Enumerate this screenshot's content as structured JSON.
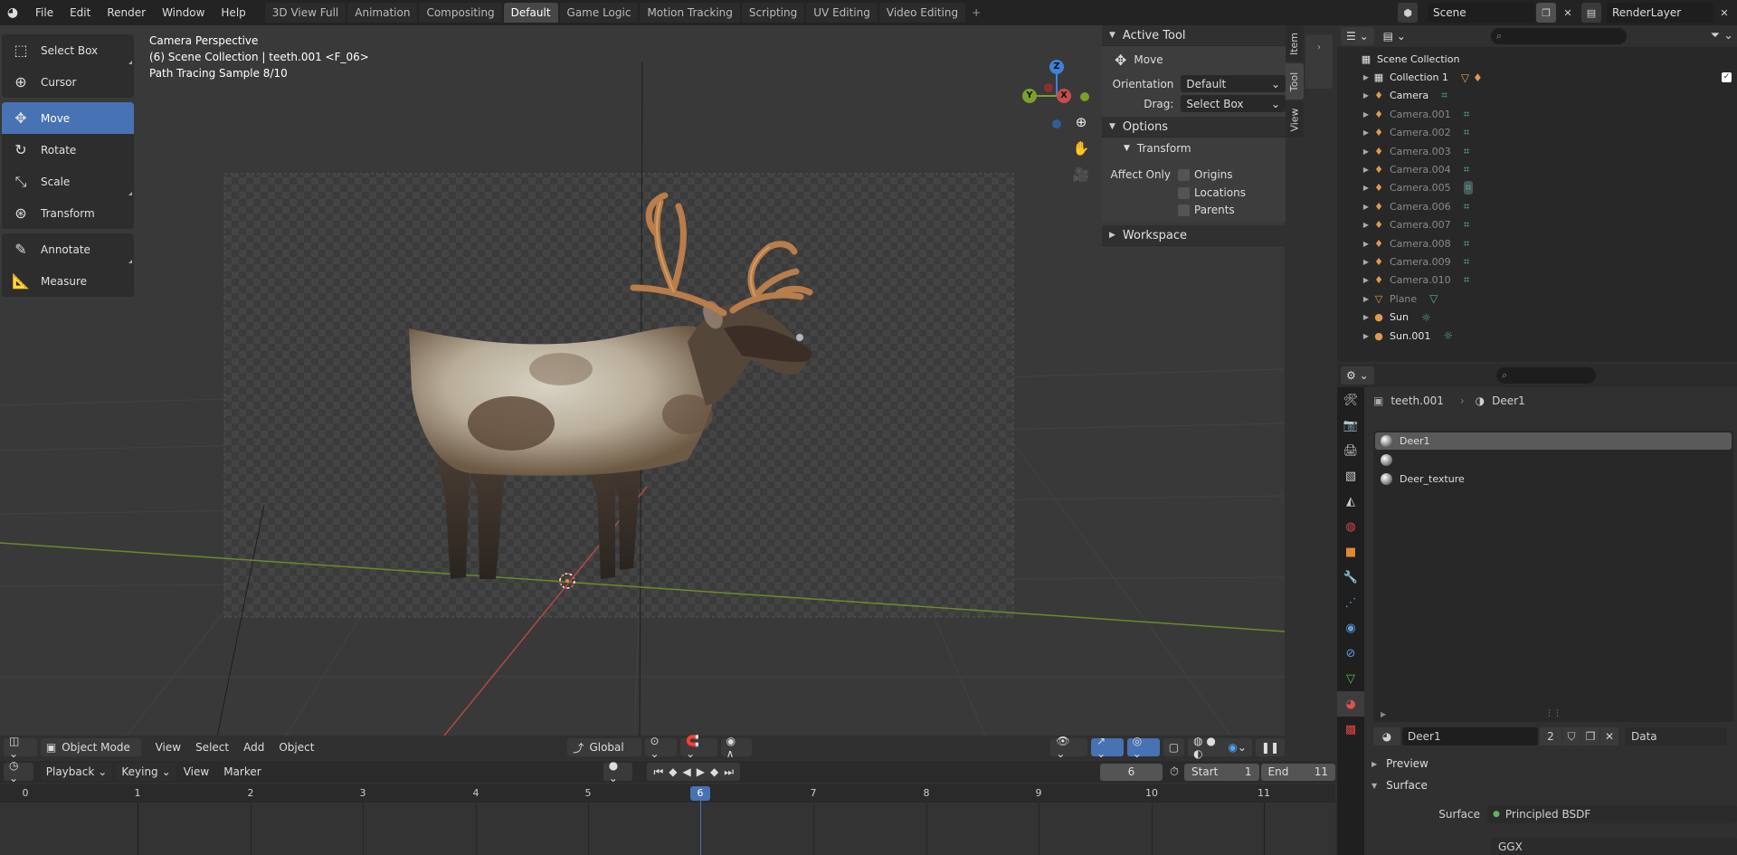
{
  "topbar": {
    "menus": [
      "File",
      "Edit",
      "Render",
      "Window",
      "Help"
    ],
    "workspaces": [
      "3D View Full",
      "Animation",
      "Compositing",
      "Default",
      "Game Logic",
      "Motion Tracking",
      "Scripting",
      "UV Editing",
      "Video Editing"
    ],
    "active_workspace": "Default",
    "add_tab": "+",
    "scene": "Scene",
    "render_layer": "RenderLayer"
  },
  "viewport": {
    "info_line1": "Camera Perspective",
    "info_line2": "(6) Scene Collection | teeth.001 <F_06>",
    "info_line3": "Path Tracing Sample 8/10"
  },
  "gizmo": {
    "z": "Z",
    "y": "Y",
    "x": "X"
  },
  "tools": {
    "select_box": "Select Box",
    "cursor": "Cursor",
    "move": "Move",
    "rotate": "Rotate",
    "scale": "Scale",
    "transform": "Transform",
    "annotate": "Annotate",
    "measure": "Measure"
  },
  "npanel": {
    "active_tool_header": "Active Tool",
    "active_tool_name": "Move",
    "orientation_label": "Orientation",
    "orientation_value": "Default",
    "drag_label": "Drag:",
    "drag_value": "Select Box",
    "options_header": "Options",
    "transform_sub": "Transform",
    "affect_only_label": "Affect Only",
    "origins": "Origins",
    "locations": "Locations",
    "parents": "Parents",
    "workspace_header": "Workspace",
    "tabs": [
      "Item",
      "Tool",
      "View"
    ]
  },
  "vp_header": {
    "mode": "Object Mode",
    "menus": [
      "View",
      "Select",
      "Add",
      "Object"
    ],
    "orientation": "Global"
  },
  "timeline": {
    "menus": [
      "Playback",
      "Keying",
      "View",
      "Marker"
    ],
    "current_frame": "6",
    "start_label": "Start",
    "start_value": "1",
    "end_label": "End",
    "end_value": "11",
    "ruler": [
      "0",
      "1",
      "2",
      "3",
      "4",
      "5",
      "6",
      "7",
      "8",
      "9",
      "10",
      "11"
    ]
  },
  "outliner": {
    "root": "Scene Collection",
    "collection": "Collection 1",
    "items": [
      {
        "name": "Camera",
        "dim": false
      },
      {
        "name": "Camera.001",
        "dim": true
      },
      {
        "name": "Camera.002",
        "dim": true
      },
      {
        "name": "Camera.003",
        "dim": true
      },
      {
        "name": "Camera.004",
        "dim": true
      },
      {
        "name": "Camera.005",
        "dim": true
      },
      {
        "name": "Camera.006",
        "dim": true
      },
      {
        "name": "Camera.007",
        "dim": true
      },
      {
        "name": "Camera.008",
        "dim": true
      },
      {
        "name": "Camera.009",
        "dim": true
      },
      {
        "name": "Camera.010",
        "dim": true
      },
      {
        "name": "Plane",
        "dim": true
      },
      {
        "name": "Sun",
        "dim": false
      },
      {
        "name": "Sun.001",
        "dim": false
      }
    ]
  },
  "properties": {
    "breadcrumb_object": "teeth.001",
    "breadcrumb_material": "Deer1",
    "materials": [
      "Deer1",
      "",
      "Deer_texture"
    ],
    "material_name": "Deer1",
    "users": "2",
    "data_label": "Data",
    "preview_header": "Preview",
    "surface_header": "Surface",
    "surface_label": "Surface",
    "surface_value": "Principled BSDF",
    "distribution_value": "GGX"
  },
  "colors": {
    "accent": "#4772b3",
    "x_axis": "#c94c4c",
    "y_axis": "#7aa02a",
    "z_axis": "#3c83d6"
  }
}
